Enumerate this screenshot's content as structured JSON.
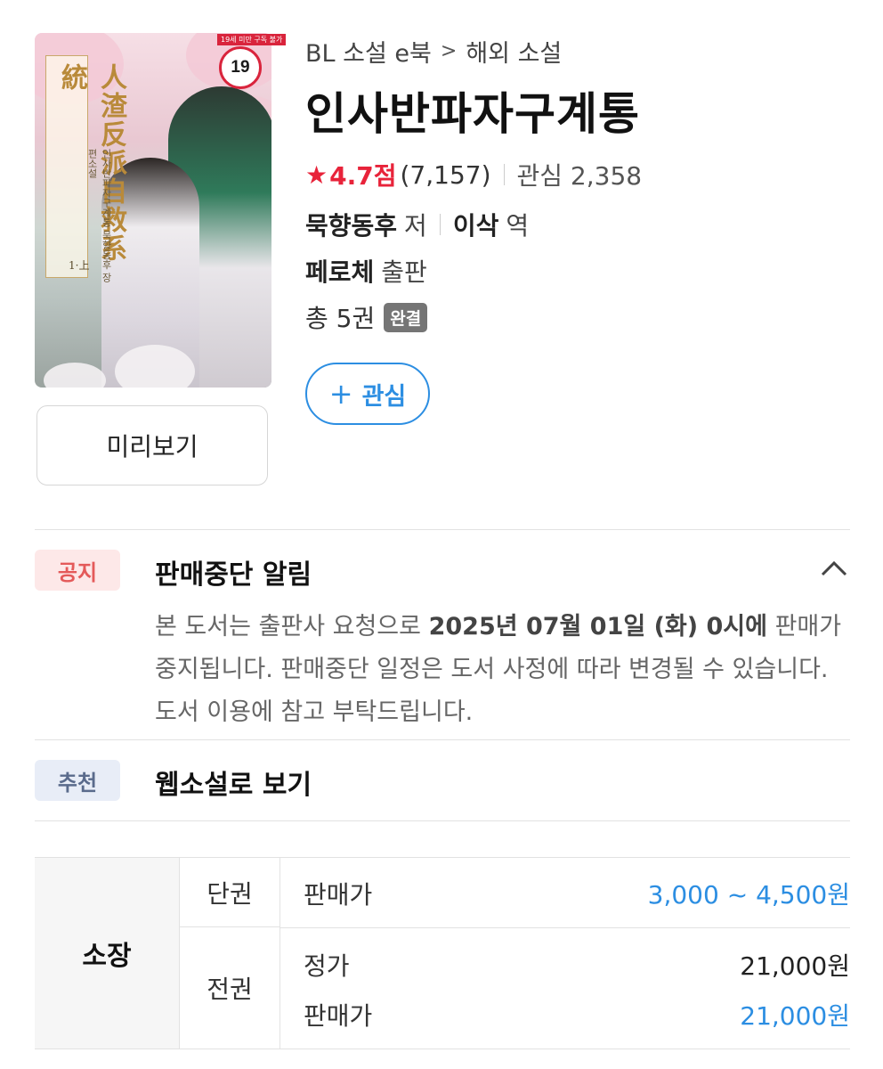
{
  "cover": {
    "age_rating": "19",
    "age_tag": "19세 미만 구독 불가",
    "title_text": "人渣反派自救系統",
    "subtitle_text": "인사반파자구계통 묵향동후 장편소설",
    "volume_text": "1·上"
  },
  "preview_label": "미리보기",
  "breadcrumb": {
    "category": "BL 소설 e북",
    "separator": ">",
    "subcategory": "해외 소설"
  },
  "title": "인사반파자구계통",
  "rating": {
    "star_icon": "star-icon",
    "score": "4.7점",
    "count": "(7,157)",
    "interest": "관심 2,358"
  },
  "author": {
    "name": "묵향동후",
    "role": "저"
  },
  "translator": {
    "name": "이삭",
    "role": "역"
  },
  "publisher": {
    "name": "페로체",
    "role": "출판"
  },
  "volumes": {
    "text": "총 5권",
    "status_badge": "완결"
  },
  "wish_button": {
    "icon": "plus-icon",
    "label": "관심"
  },
  "notice": {
    "tag": "공지",
    "title": "판매중단 알림",
    "body_prefix": "본 도서는 출판사 요청으로 ",
    "body_bold": "2025년 07월 01일 (화) 0시에",
    "body_suffix": " 판매가 중지됩니다. 판매중단 일정은 도서 사정에 따라 변경될 수 있습니다. 도서 이용에 참고 부탁드립니다."
  },
  "recommend": {
    "tag": "추천",
    "title": "웹소설로 보기"
  },
  "price_table": {
    "ownership_label": "소장",
    "single": {
      "label": "단권",
      "price_label": "판매가",
      "price": "3,000 ~ 4,500원"
    },
    "full": {
      "label": "전권",
      "list_price_label": "정가",
      "list_price": "21,000원",
      "sale_price_label": "판매가",
      "sale_price": "21,000원"
    }
  },
  "colors": {
    "accent_blue": "#2c8ee2",
    "rating_red": "#e8233a",
    "notice_bg": "#fde8e8",
    "reco_bg": "#e8edf7"
  }
}
